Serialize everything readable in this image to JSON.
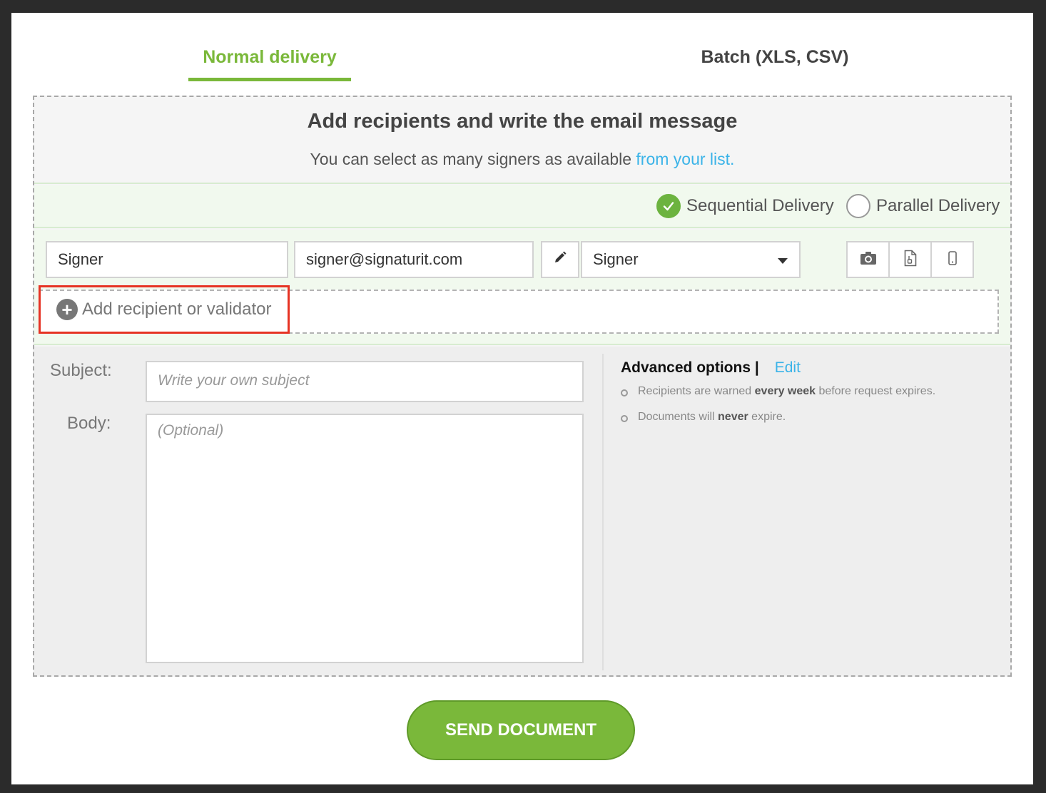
{
  "tabs": {
    "normal": "Normal delivery",
    "batch": "Batch (XLS, CSV)"
  },
  "panel": {
    "title": "Add recipients and write the email message",
    "subtitle": "You can select as many signers as available",
    "subtitle_link": "from your list."
  },
  "delivery": {
    "sequential": "Sequential Delivery",
    "parallel": "Parallel Delivery",
    "selected": "Sequential Delivery"
  },
  "recipient": {
    "name": "Signer",
    "email": "signer@signaturit.com",
    "role": "Signer"
  },
  "add_recipient": "Add recipient or validator",
  "message": {
    "subject_label": "Subject:",
    "subject_placeholder": "Write your own subject",
    "body_label": "Body:",
    "body_placeholder": "(Optional)"
  },
  "advanced": {
    "title": "Advanced options |",
    "edit": "Edit",
    "items": [
      {
        "pre": "Recipients are warned ",
        "bold": "every week",
        "post": " before request expires."
      },
      {
        "pre": "Documents will ",
        "bold": "never",
        "post": " expire."
      }
    ]
  },
  "send_button": "SEND DOCUMENT",
  "icons": [
    "pencil-icon",
    "camera-icon",
    "document-icon",
    "mobile-icon",
    "plus-circle-icon",
    "check-icon",
    "caret-down-icon"
  ],
  "colors": {
    "accent_green": "#7ab83a",
    "link_blue": "#3ab3e8",
    "highlight_red": "#e63323"
  }
}
